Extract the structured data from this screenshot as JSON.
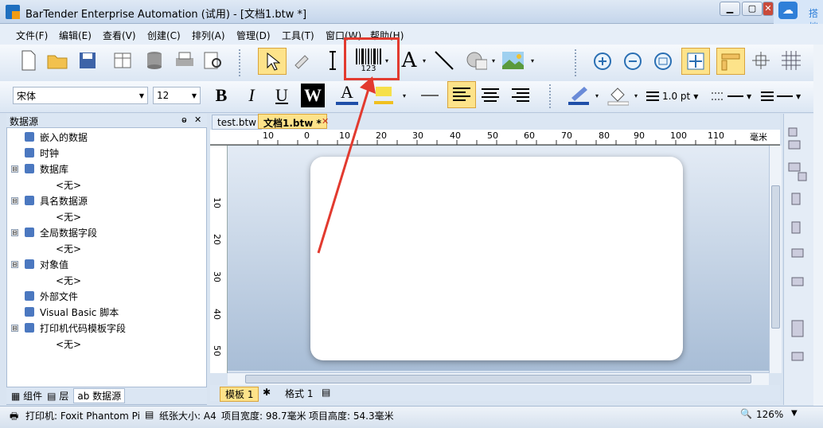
{
  "window": {
    "title": "BarTender Enterprise Automation (试用) - [文档1.btw *]"
  },
  "cloud_label": "搭档",
  "menu": [
    "文件(F)",
    "编辑(E)",
    "查看(V)",
    "创建(C)",
    "排列(A)",
    "管理(D)",
    "工具(T)",
    "窗口(W)",
    "帮助(H)"
  ],
  "format_toolbar": {
    "font": "宋体",
    "size": "12",
    "line_width": "1.0 pt"
  },
  "barcode_tool_label": "123",
  "datasource": {
    "header": "数据源",
    "items": [
      {
        "label": "嵌入的数据",
        "icon": "embedded-data-icon",
        "expand": ""
      },
      {
        "label": "时钟",
        "icon": "clock-icon",
        "expand": ""
      },
      {
        "label": "数据库",
        "icon": "database-icon",
        "expand": "⊟"
      },
      {
        "label": "<无>",
        "icon": "",
        "expand": "",
        "child": true
      },
      {
        "label": "具名数据源",
        "icon": "named-datasource-icon",
        "expand": "⊟"
      },
      {
        "label": "<无>",
        "icon": "",
        "expand": "",
        "child": true
      },
      {
        "label": "全局数据字段",
        "icon": "globe-icon",
        "expand": "⊟"
      },
      {
        "label": "<无>",
        "icon": "",
        "expand": "",
        "child": true
      },
      {
        "label": "对象值",
        "icon": "object-value-icon",
        "expand": "⊟"
      },
      {
        "label": "<无>",
        "icon": "",
        "expand": "",
        "child": true
      },
      {
        "label": "外部文件",
        "icon": "disk-icon",
        "expand": ""
      },
      {
        "label": "Visual Basic 脚本",
        "icon": "vb-script-icon",
        "expand": ""
      },
      {
        "label": "打印机代码模板字段",
        "icon": "printer-code-icon",
        "expand": "⊟"
      },
      {
        "label": "<无>",
        "icon": "",
        "expand": "",
        "child": true
      }
    ],
    "bottom_tabs": [
      "组件",
      "层",
      "数据源"
    ]
  },
  "doc_tabs": [
    "test.btw",
    "文档1.btw *"
  ],
  "ruler": {
    "h_ticks": [
      "10",
      "0",
      "10",
      "20",
      "30",
      "40",
      "50",
      "60",
      "70",
      "80",
      "90",
      "100",
      "110"
    ],
    "unit": "毫米",
    "v_ticks": [
      "10",
      "20",
      "30",
      "40",
      "50"
    ]
  },
  "page_tabs": [
    "模板 1",
    "格式 1"
  ],
  "status": {
    "printer": "打印机: Foxit Phantom Pi",
    "paper": "纸张大小: A4",
    "width": "项目宽度: 98.7毫米",
    "height": "项目高度: 54.3毫米",
    "zoom": "126%"
  }
}
